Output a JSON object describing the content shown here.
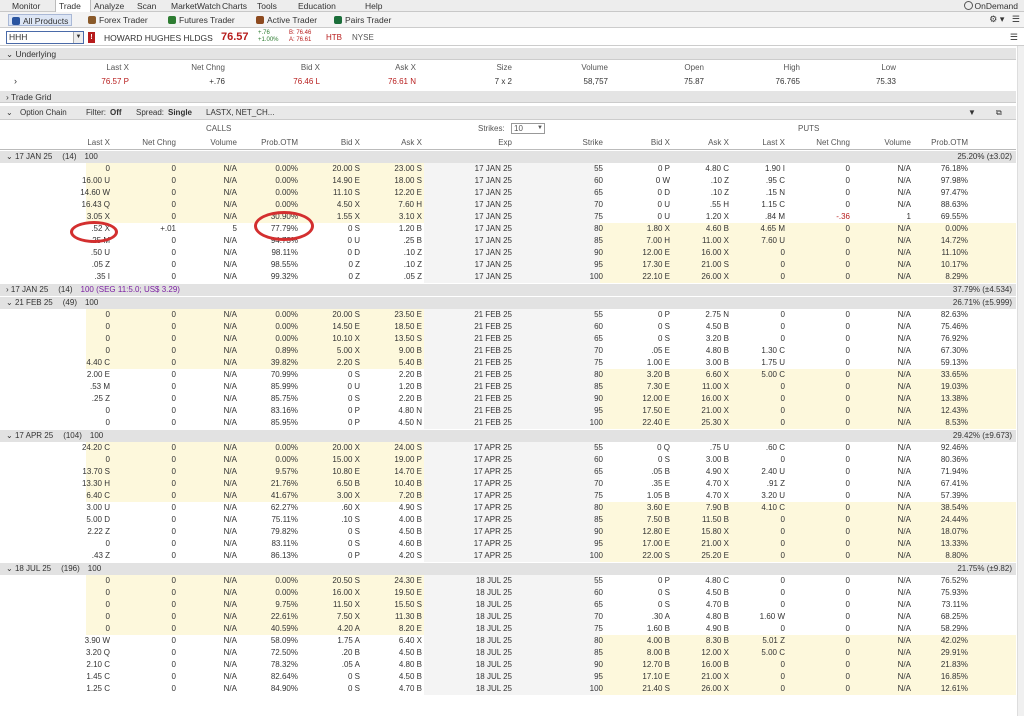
{
  "menu": {
    "items": [
      "Monitor",
      "Trade",
      "Analyze",
      "Scan",
      "MarketWatch",
      "Charts",
      "Tools",
      "Education",
      "Help"
    ],
    "active": "Trade",
    "ondemand": "OnDemand"
  },
  "subtabs": [
    "All Products",
    "Forex Trader",
    "Futures Trader",
    "Active Trader",
    "Pairs Trader"
  ],
  "symbol": {
    "input": "HHH",
    "name": "HOWARD HUGHES HLDGS",
    "last": "76.57",
    "chg": "+.76",
    "chgpct": "+1.00%",
    "bid": "B: 76.46",
    "ask": "A: 76.61",
    "htb": "HTB",
    "exch": "NYSE"
  },
  "underlying": {
    "title": "Underlying",
    "headers": [
      "Last X",
      "Net Chng",
      "Bid X",
      "Ask X",
      "Size",
      "Volume",
      "Open",
      "High",
      "Low"
    ],
    "values": [
      "76.57 P",
      "+.76",
      "76.46 L",
      "76.61 N",
      "7 x 2",
      "58,757",
      "75.87",
      "76.765",
      "75.33"
    ]
  },
  "tradegrid": "Trade Grid",
  "optionchain": {
    "title": "Option Chain",
    "filter_label": "Filter:",
    "filter": "Off",
    "spread_label": "Spread:",
    "spread": "Single",
    "layout": "LASTX, NET_CH...",
    "strikes_label": "Strikes:",
    "strikes": "10",
    "calls": "CALLS",
    "puts": "PUTS"
  },
  "columns": {
    "call": [
      "Last X",
      "Net Chng",
      "Volume",
      "Prob.OTM",
      "Bid X",
      "Ask X"
    ],
    "mid": [
      "Exp",
      "Strike"
    ],
    "put": [
      "Bid X",
      "Ask X",
      "Last X",
      "Net Chng",
      "Volume",
      "Prob.OTM"
    ]
  },
  "series": [
    {
      "label": "17 JAN 25",
      "count": "(14)",
      "mult": "100",
      "iv": "25.20% (±3.02)",
      "rows": [
        [
          "0",
          "0",
          "N/A",
          "0.00%",
          "20.00 S",
          "23.00 S",
          "17 JAN 25",
          "55",
          "0 P",
          "4.80 C",
          "1.90 I",
          "0",
          "N/A",
          "76.18%"
        ],
        [
          "16.00 U",
          "0",
          "N/A",
          "0.00%",
          "14.90 E",
          "18.00 S",
          "17 JAN 25",
          "60",
          "0 W",
          ".10 Z",
          ".95 C",
          "0",
          "N/A",
          "97.98%"
        ],
        [
          "14.60 W",
          "0",
          "N/A",
          "0.00%",
          "11.10 S",
          "12.20 E",
          "17 JAN 25",
          "65",
          "0 D",
          ".10 Z",
          ".15 N",
          "0",
          "N/A",
          "97.47%"
        ],
        [
          "16.43 Q",
          "0",
          "N/A",
          "0.00%",
          "4.50 X",
          "7.60 H",
          "17 JAN 25",
          "70",
          "0 U",
          ".55 H",
          "1.15 C",
          "0",
          "N/A",
          "88.63%"
        ],
        [
          "3.05 X",
          "0",
          "N/A",
          "30.90%",
          "1.55 X",
          "3.10 X",
          "17 JAN 25",
          "75",
          "0 U",
          "1.20 X",
          ".84 M",
          "-.36",
          "1",
          "69.55%"
        ],
        [
          ".52 X",
          "+.01",
          "5",
          "77.79%",
          "0 S",
          "1.20 B",
          "17 JAN 25",
          "80",
          "1.80 X",
          "4.60 B",
          "4.65 M",
          "0",
          "N/A",
          "0.00%"
        ],
        [
          ".25 M",
          "0",
          "N/A",
          "94.73%",
          "0 U",
          ".25 B",
          "17 JAN 25",
          "85",
          "7.00 H",
          "11.00 X",
          "7.60 U",
          "0",
          "N/A",
          "14.72%"
        ],
        [
          ".50 U",
          "0",
          "N/A",
          "98.11%",
          "0 D",
          ".10 Z",
          "17 JAN 25",
          "90",
          "12.00 E",
          "16.00 X",
          "0",
          "0",
          "N/A",
          "11.10%"
        ],
        [
          ".05 Z",
          "0",
          "N/A",
          "98.55%",
          "0 Z",
          ".10 Z",
          "17 JAN 25",
          "95",
          "17.30 E",
          "21.00 S",
          "0",
          "0",
          "N/A",
          "10.17%"
        ],
        [
          ".35 I",
          "0",
          "N/A",
          "99.32%",
          "0 Z",
          ".05 Z",
          "17 JAN 25",
          "100",
          "22.10 E",
          "26.00 X",
          "0",
          "0",
          "N/A",
          "8.29%"
        ]
      ]
    },
    {
      "label": "17 JAN 25",
      "count": "(14)",
      "mult": "100 (SEG 11:5.0; US$ 3.29)",
      "iv": "37.79% (±4.534)",
      "collapsed": true,
      "rows": []
    },
    {
      "label": "21 FEB 25",
      "count": "(49)",
      "mult": "100",
      "iv": "26.71% (±5.999)",
      "rows": [
        [
          "0",
          "0",
          "N/A",
          "0.00%",
          "20.00 S",
          "23.50 E",
          "21 FEB 25",
          "55",
          "0 P",
          "2.75 N",
          "0",
          "0",
          "N/A",
          "82.63%"
        ],
        [
          "0",
          "0",
          "N/A",
          "0.00%",
          "14.50 E",
          "18.50 E",
          "21 FEB 25",
          "60",
          "0 S",
          "4.50 B",
          "0",
          "0",
          "N/A",
          "75.46%"
        ],
        [
          "0",
          "0",
          "N/A",
          "0.00%",
          "10.10 X",
          "13.50 S",
          "21 FEB 25",
          "65",
          "0 S",
          "3.20 B",
          "0",
          "0",
          "N/A",
          "76.92%"
        ],
        [
          "0",
          "0",
          "N/A",
          "0.89%",
          "5.00 X",
          "9.00 B",
          "21 FEB 25",
          "70",
          ".05 E",
          "4.80 B",
          "1.30 C",
          "0",
          "N/A",
          "67.30%"
        ],
        [
          "4.40 C",
          "0",
          "N/A",
          "39.82%",
          "2.20 S",
          "5.40 B",
          "21 FEB 25",
          "75",
          "1.00 E",
          "3.00 B",
          "1.75 U",
          "0",
          "N/A",
          "59.13%"
        ],
        [
          "2.00 E",
          "0",
          "N/A",
          "70.99%",
          "0 S",
          "2.20 B",
          "21 FEB 25",
          "80",
          "3.20 B",
          "6.60 X",
          "5.00 C",
          "0",
          "N/A",
          "33.65%"
        ],
        [
          ".53 M",
          "0",
          "N/A",
          "85.99%",
          "0 U",
          "1.20 B",
          "21 FEB 25",
          "85",
          "7.30 E",
          "11.00 X",
          "0",
          "0",
          "N/A",
          "19.03%"
        ],
        [
          ".25 Z",
          "0",
          "N/A",
          "85.75%",
          "0 S",
          "2.20 B",
          "21 FEB 25",
          "90",
          "12.00 E",
          "16.00 X",
          "0",
          "0",
          "N/A",
          "13.38%"
        ],
        [
          "0",
          "0",
          "N/A",
          "83.16%",
          "0 P",
          "4.80 N",
          "21 FEB 25",
          "95",
          "17.50 E",
          "21.00 X",
          "0",
          "0",
          "N/A",
          "12.43%"
        ],
        [
          "0",
          "0",
          "N/A",
          "85.95%",
          "0 P",
          "4.50 N",
          "21 FEB 25",
          "100",
          "22.40 E",
          "25.30 X",
          "0",
          "0",
          "N/A",
          "8.53%"
        ]
      ]
    },
    {
      "label": "17 APR 25",
      "count": "(104)",
      "mult": "100",
      "iv": "29.42% (±9.673)",
      "rows": [
        [
          "24.20 C",
          "0",
          "N/A",
          "0.00%",
          "20.00 X",
          "24.00 S",
          "17 APR 25",
          "55",
          "0 Q",
          ".75 U",
          ".60 C",
          "0",
          "N/A",
          "92.46%"
        ],
        [
          "0",
          "0",
          "N/A",
          "0.00%",
          "15.00 X",
          "19.00 P",
          "17 APR 25",
          "60",
          "0 S",
          "3.00 B",
          "0",
          "0",
          "N/A",
          "80.36%"
        ],
        [
          "13.70 S",
          "0",
          "N/A",
          "9.57%",
          "10.80 E",
          "14.70 E",
          "17 APR 25",
          "65",
          ".05 B",
          "4.90 X",
          "2.40 U",
          "0",
          "N/A",
          "71.94%"
        ],
        [
          "13.30 H",
          "0",
          "N/A",
          "21.76%",
          "6.50 B",
          "10.40 B",
          "17 APR 25",
          "70",
          ".35 E",
          "4.70 X",
          ".91 Z",
          "0",
          "N/A",
          "67.41%"
        ],
        [
          "6.40 C",
          "0",
          "N/A",
          "41.67%",
          "3.00 X",
          "7.20 B",
          "17 APR 25",
          "75",
          "1.05 B",
          "4.70 X",
          "3.20 U",
          "0",
          "N/A",
          "57.39%"
        ],
        [
          "3.00 U",
          "0",
          "N/A",
          "62.27%",
          ".60 X",
          "4.90 S",
          "17 APR 25",
          "80",
          "3.60 E",
          "7.90 B",
          "4.10 C",
          "0",
          "N/A",
          "38.54%"
        ],
        [
          "5.00 D",
          "0",
          "N/A",
          "75.11%",
          ".10 S",
          "4.00 B",
          "17 APR 25",
          "85",
          "7.50 B",
          "11.50 B",
          "0",
          "0",
          "N/A",
          "24.44%"
        ],
        [
          "2.22 Z",
          "0",
          "N/A",
          "79.82%",
          "0 S",
          "4.50 B",
          "17 APR 25",
          "90",
          "12.80 E",
          "15.80 X",
          "0",
          "0",
          "N/A",
          "18.07%"
        ],
        [
          "0",
          "0",
          "N/A",
          "83.11%",
          "0 S",
          "4.60 B",
          "17 APR 25",
          "95",
          "17.00 E",
          "21.00 X",
          "0",
          "0",
          "N/A",
          "13.33%"
        ],
        [
          ".43 Z",
          "0",
          "N/A",
          "86.13%",
          "0 P",
          "4.20 S",
          "17 APR 25",
          "100",
          "22.00 S",
          "25.20 E",
          "0",
          "0",
          "N/A",
          "8.80%"
        ]
      ]
    },
    {
      "label": "18 JUL 25",
      "count": "(196)",
      "mult": "100",
      "iv": "21.75% (±9.82)",
      "rows": [
        [
          "0",
          "0",
          "N/A",
          "0.00%",
          "20.50 S",
          "24.30 E",
          "18 JUL 25",
          "55",
          "0 P",
          "4.80 C",
          "0",
          "0",
          "N/A",
          "76.52%"
        ],
        [
          "0",
          "0",
          "N/A",
          "0.00%",
          "16.00 X",
          "19.50 E",
          "18 JUL 25",
          "60",
          "0 S",
          "4.50 B",
          "0",
          "0",
          "N/A",
          "75.93%"
        ],
        [
          "0",
          "0",
          "N/A",
          "9.75%",
          "11.50 X",
          "15.50 S",
          "18 JUL 25",
          "65",
          "0 S",
          "4.70 B",
          "0",
          "0",
          "N/A",
          "73.11%"
        ],
        [
          "0",
          "0",
          "N/A",
          "22.61%",
          "7.50 X",
          "11.30 B",
          "18 JUL 25",
          "70",
          ".30 A",
          "4.80 B",
          "1.60 W",
          "0",
          "N/A",
          "68.25%"
        ],
        [
          "0",
          "0",
          "N/A",
          "40.59%",
          "4.20 A",
          "8.20 E",
          "18 JUL 25",
          "75",
          "1.60 B",
          "4.90 B",
          "0",
          "0",
          "N/A",
          "58.29%"
        ],
        [
          "3.90 W",
          "0",
          "N/A",
          "58.09%",
          "1.75 A",
          "6.40 X",
          "18 JUL 25",
          "80",
          "4.00 B",
          "8.30 B",
          "5.01 Z",
          "0",
          "N/A",
          "42.02%"
        ],
        [
          "3.20 Q",
          "0",
          "N/A",
          "72.50%",
          ".20 B",
          "4.50 B",
          "18 JUL 25",
          "85",
          "8.00 B",
          "12.00 X",
          "5.00 C",
          "0",
          "N/A",
          "29.91%"
        ],
        [
          "2.10 C",
          "0",
          "N/A",
          "78.32%",
          ".05 A",
          "4.80 B",
          "18 JUL 25",
          "90",
          "12.70 B",
          "16.00 B",
          "0",
          "0",
          "N/A",
          "21.83%"
        ],
        [
          "1.45 C",
          "0",
          "N/A",
          "82.64%",
          "0 S",
          "4.50 B",
          "18 JUL 25",
          "95",
          "17.10 E",
          "21.00 X",
          "0",
          "0",
          "N/A",
          "16.85%"
        ],
        [
          "1.25 C",
          "0",
          "N/A",
          "84.90%",
          "0 S",
          "4.70 B",
          "18 JUL 25",
          "100",
          "21.40 S",
          "26.00 X",
          "0",
          "0",
          "N/A",
          "12.61%"
        ]
      ]
    }
  ]
}
